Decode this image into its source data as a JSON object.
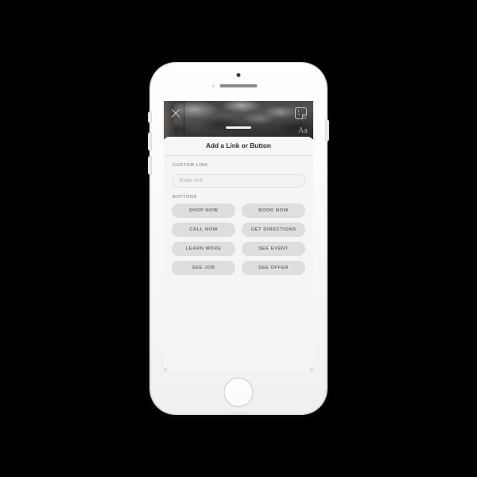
{
  "device": {
    "name": "iphone-white",
    "icons": {
      "camera": "camera-dot",
      "earpiece": "earpiece-speaker",
      "home": "home-button"
    }
  },
  "photo_overlay": {
    "close_label": "×",
    "close_icon": "close-x-icon",
    "sticker_icon": "sticker-icon",
    "text_tool_label": "Aa",
    "text_tool_icon": "text-tool-icon",
    "drag_handle": "drag-handle"
  },
  "sheet": {
    "title": "Add a Link or Button",
    "custom_link": {
      "label": "CUSTOM LINK",
      "placeholder": "Enter link",
      "value": ""
    },
    "buttons_section": {
      "label": "BUTTONS",
      "items": [
        {
          "label": "SHOP NOW"
        },
        {
          "label": "BOOK NOW"
        },
        {
          "label": "CALL NOW"
        },
        {
          "label": "GET DIRECTIONS"
        },
        {
          "label": "LEARN MORE"
        },
        {
          "label": "SEE EVENT"
        },
        {
          "label": "SEE JOB"
        },
        {
          "label": "SEE OFFER"
        }
      ]
    }
  },
  "colors": {
    "background": "#000000",
    "device_body": "#fbfbfb",
    "sheet_background": "#f5f5f5",
    "button_fill": "#dedede",
    "button_text": "#6f6f6f",
    "label_text": "#9b9b9b",
    "title_text": "#2b2b2b",
    "placeholder_text": "#b6b6b6"
  }
}
